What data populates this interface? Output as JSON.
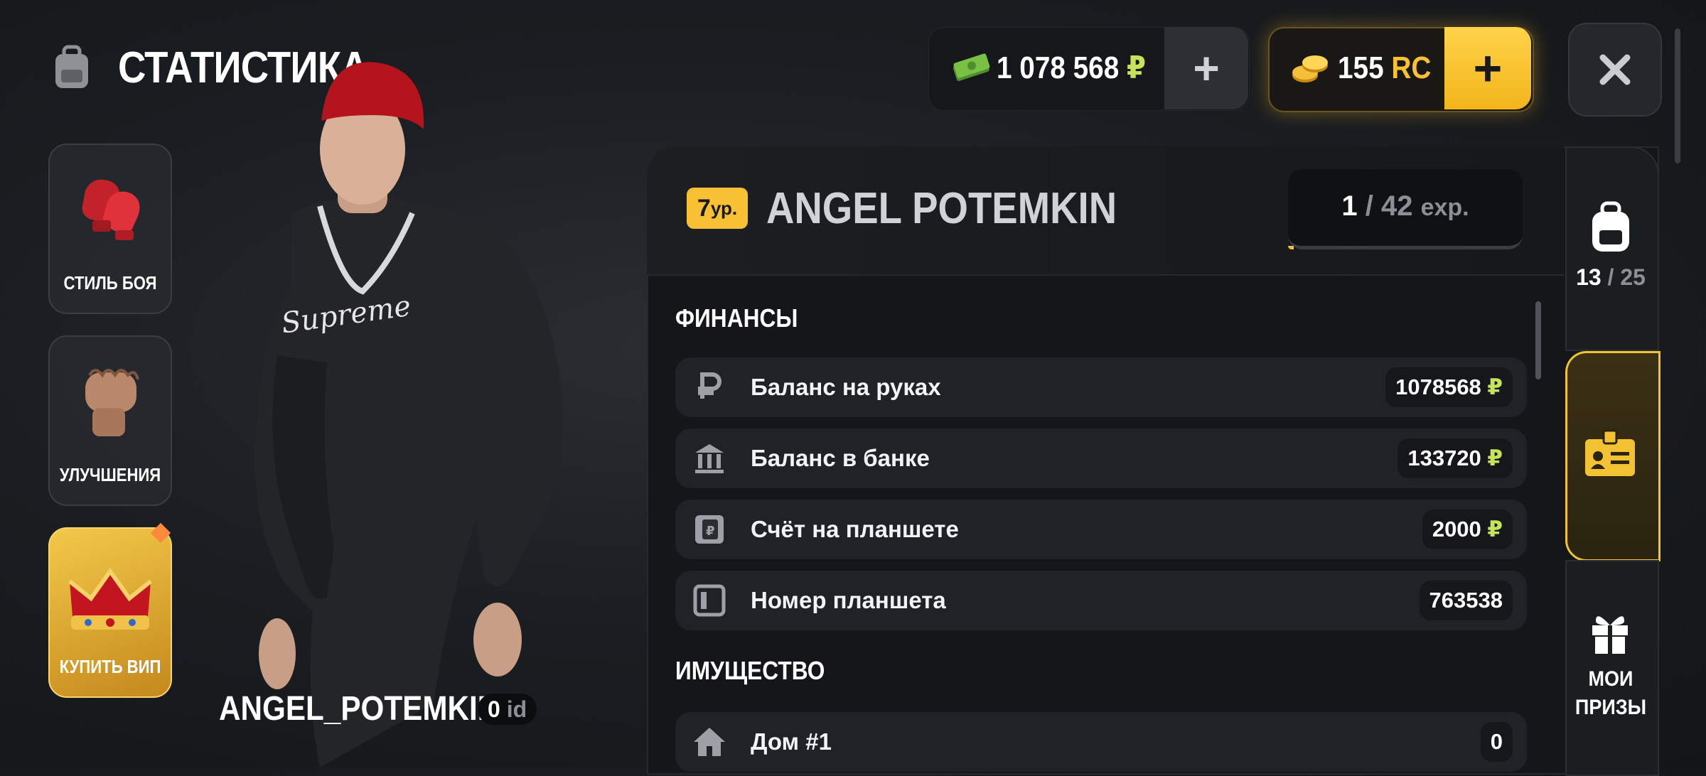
{
  "header": {
    "title": "СТАТИСТИКА",
    "cash": {
      "value": "1 078 568",
      "currency": "₽",
      "plus": "+"
    },
    "coins": {
      "value": "155",
      "currency": "RC",
      "plus": "+"
    },
    "close_icon": "close-icon"
  },
  "sidebar": {
    "items": [
      {
        "label": "СТИЛЬ БОЯ",
        "icon": "boxing-gloves-icon"
      },
      {
        "label": "УЛУЧШЕНИЯ",
        "icon": "fist-icon"
      },
      {
        "label": "КУПИТЬ ВИП",
        "icon": "crown-icon"
      }
    ]
  },
  "character": {
    "name": "ANGEL_POTEMKIN",
    "id_value": "0",
    "id_label": "id"
  },
  "profile": {
    "level": "7",
    "level_suffix": "ур.",
    "player_name": "ANGEL POTEMKIN",
    "exp_current": "1",
    "exp_sep": "/",
    "exp_max": "42",
    "exp_unit": "exp.",
    "exp_progress": 0.024
  },
  "finances": {
    "title": "ФИНАНСЫ",
    "rows": [
      {
        "label": "Баланс на руках",
        "value": "1078568",
        "currency": "₽",
        "icon": "ruble-icon"
      },
      {
        "label": "Баланс в банке",
        "value": "133720",
        "currency": "₽",
        "icon": "bank-icon"
      },
      {
        "label": "Счёт на планшете",
        "value": "2000",
        "currency": "₽",
        "icon": "tablet-wallet-icon"
      },
      {
        "label": "Номер планшета",
        "value": "763538",
        "currency": "",
        "icon": "tablet-icon"
      }
    ]
  },
  "property": {
    "title": "ИМУЩЕСТВО",
    "rows": [
      {
        "label": "Дом #1",
        "value": "0",
        "icon": "house-icon"
      }
    ]
  },
  "right_tabs": {
    "inventory": {
      "current": "13",
      "sep": "/",
      "max": "25",
      "icon": "backpack-icon"
    },
    "id_card": {
      "icon": "id-card-icon",
      "active": true
    },
    "prizes": {
      "label_line1": "МОИ",
      "label_line2": "ПРИЗЫ",
      "icon": "gift-icon"
    }
  },
  "colors": {
    "accent": "#f7c133",
    "ruble": "#c7e35a",
    "panel": "#141619"
  }
}
